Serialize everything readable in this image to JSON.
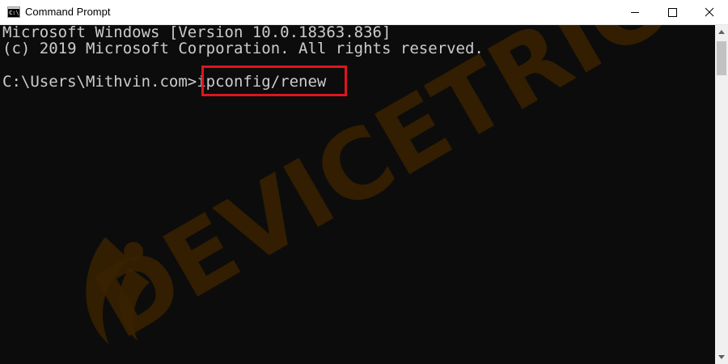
{
  "window": {
    "title": "Command Prompt",
    "icon": "cmd-icon",
    "controls": [
      "minimize-icon",
      "maximize-icon",
      "close-icon"
    ]
  },
  "console": {
    "lines": [
      "Microsoft Windows [Version 10.0.18363.836]",
      "(c) 2019 Microsoft Corporation. All rights reserved."
    ],
    "prompt": "C:\\Users\\Mithvin.com>",
    "command": "ipconfig/renew",
    "text_color": "#cccccc",
    "background_color": "#0c0c0c",
    "highlight_color": "#e0141e"
  },
  "watermark": {
    "text": "DEVICETRICKS",
    "color": "#3a2200"
  }
}
